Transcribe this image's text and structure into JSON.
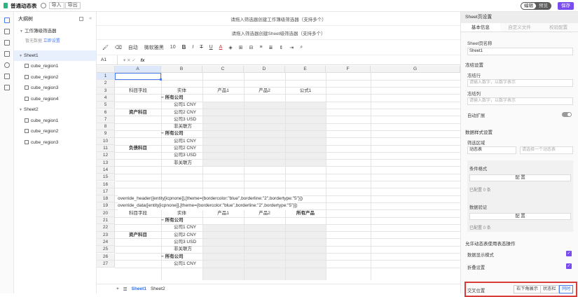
{
  "app": {
    "title": "普通动态表",
    "import_label": "导入",
    "export_label": "导出"
  },
  "mode_switch": {
    "edit": "编辑",
    "preview": "预览"
  },
  "save_label": "保存",
  "tree": {
    "header": "大纲树",
    "filter_title": "工作簿级筛选器",
    "filter_hint": "暂无数据",
    "filter_link": "立即设置",
    "sheets": [
      {
        "name": "Sheet1",
        "regions": [
          "cube_region1",
          "cube_region2",
          "cube_region3",
          "cube_region4"
        ]
      },
      {
        "name": "Sheet2",
        "regions": [
          "cube_region1",
          "cube_region2",
          "cube_region3"
        ]
      }
    ]
  },
  "main": {
    "filter_line1": "请拖入筛选器创建工作簿级筛选器（支持多个）",
    "filter_line2": "请拖入筛选器创建Sheet级筛选器（支持多个）",
    "toolbar": {
      "auto": "自动",
      "font": "微软雅黑",
      "size": "10"
    },
    "cell_address": "A1",
    "fx": "fx",
    "columns": [
      "A",
      "B",
      "C",
      "D",
      "E",
      "F",
      "G"
    ],
    "rows": [
      "1",
      "2",
      "3",
      "4",
      "5",
      "6",
      "7",
      "8",
      "9",
      "10",
      "11",
      "12",
      "13",
      "14",
      "15",
      "16",
      "17",
      "18",
      "19",
      "20",
      "21",
      "22",
      "23",
      "24",
      "25",
      "26",
      "27"
    ],
    "sheet_tabs": [
      "Sheet1",
      "Sheet2"
    ]
  },
  "cells": {
    "r3": {
      "a": "科目字段",
      "b": "实体",
      "c": "产品1",
      "d": "产品2",
      "e": "公式1"
    },
    "entities": [
      "所有公司",
      "公司1 CNY",
      "公司2 CNY",
      "公司3 USD",
      "非关联方"
    ],
    "group1": "资产科目",
    "group2": "负债科目",
    "r18": "override_header([entity[icpnone]],[theme={bordercolor:\"blue\",borderline:\"2\",bordertype:\"5\"}])",
    "r19": "override_data([entity[icpnone]],[theme={bordercolor:\"blue\",borderline:\"2\",bordertype:\"5\"}])",
    "r20": {
      "a": "科目字段",
      "b": "实体",
      "c": "产品1",
      "d": "产品2",
      "e": "所有产品"
    },
    "group3": "资产科目",
    "r27b": "公司1 CNY"
  },
  "panel": {
    "header": "Sheet页设置",
    "tabs": [
      "基本信息",
      "自定义文件",
      "校验配置"
    ],
    "sheet_name_label": "Sheet页名称",
    "sheet_name_value": "Sheet1",
    "freeze_title": "冻结设置",
    "freeze_row_label": "冻结行",
    "freeze_row_placeholder": "请输入数字，以数字表示",
    "freeze_col_label": "冻结列",
    "freeze_col_placeholder": "请输入数字，以数字表示",
    "auto_expand": "自动扩展",
    "data_style_title": "数据样式设置",
    "filter_area_label": "筛选区域",
    "filter_area_value": "动态表",
    "filter_area_placeholder": "请选择一个动态表",
    "cond_format_label": "条件格式",
    "config_button": "配 置",
    "configured_count": "已配置 0 条",
    "data_validation_label": "数据验证",
    "allow_ops_title": "允许动态表使用表态操作",
    "data_display_mode": "数据显示模式",
    "collapse_settings": "折叠设置",
    "cross_position_label": "交叉位置",
    "positions": [
      "右下角展示",
      "状态栏",
      "同时"
    ]
  }
}
